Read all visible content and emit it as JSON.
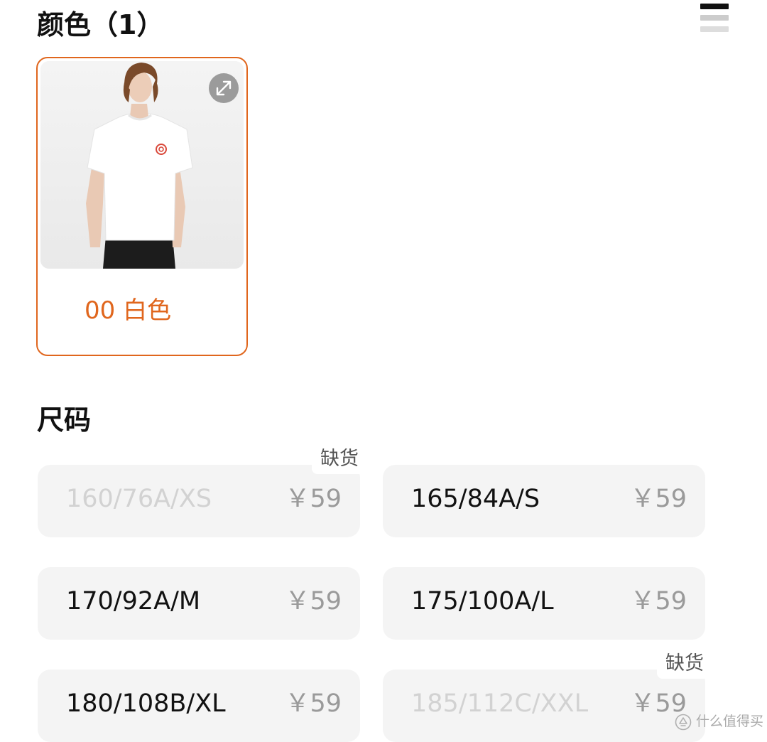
{
  "color_section": {
    "title": "颜色（1）",
    "selected_color": {
      "label": "00 白色",
      "image_description_icon": "tshirt-product-photo",
      "accent_color": "#e0661d"
    }
  },
  "view_toggle": {
    "icon": "list-view-icon"
  },
  "size_section": {
    "title": "尺码",
    "sizes": [
      {
        "label": "160/76A/XS",
        "price": "￥59",
        "available": false,
        "badge": "缺货"
      },
      {
        "label": "165/84A/S",
        "price": "￥59",
        "available": true,
        "badge": ""
      },
      {
        "label": "170/92A/M",
        "price": "￥59",
        "available": true,
        "badge": ""
      },
      {
        "label": "175/100A/L",
        "price": "￥59",
        "available": true,
        "badge": ""
      },
      {
        "label": "180/108B/XL",
        "price": "￥59",
        "available": true,
        "badge": ""
      },
      {
        "label": "185/112C/XXL",
        "price": "￥59",
        "available": false,
        "badge": "缺货"
      }
    ]
  },
  "watermark": {
    "text": "什么值得买"
  }
}
